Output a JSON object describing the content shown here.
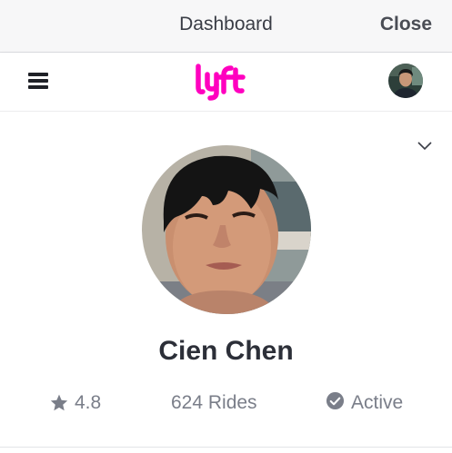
{
  "header": {
    "title": "Dashboard",
    "close_label": "Close"
  },
  "nav": {
    "logo_icon": "lyft-logo",
    "menu_icon": "hamburger-menu-icon",
    "avatar_icon": "user-avatar"
  },
  "profile": {
    "name": "Cien Chen",
    "rating": "4.8",
    "rides": "624 Rides",
    "status": "Active"
  },
  "colors": {
    "brand": "#ff00bf",
    "text_primary": "#2c2f38",
    "text_secondary": "#7a7e89",
    "header_bg": "#f7f7f8"
  }
}
